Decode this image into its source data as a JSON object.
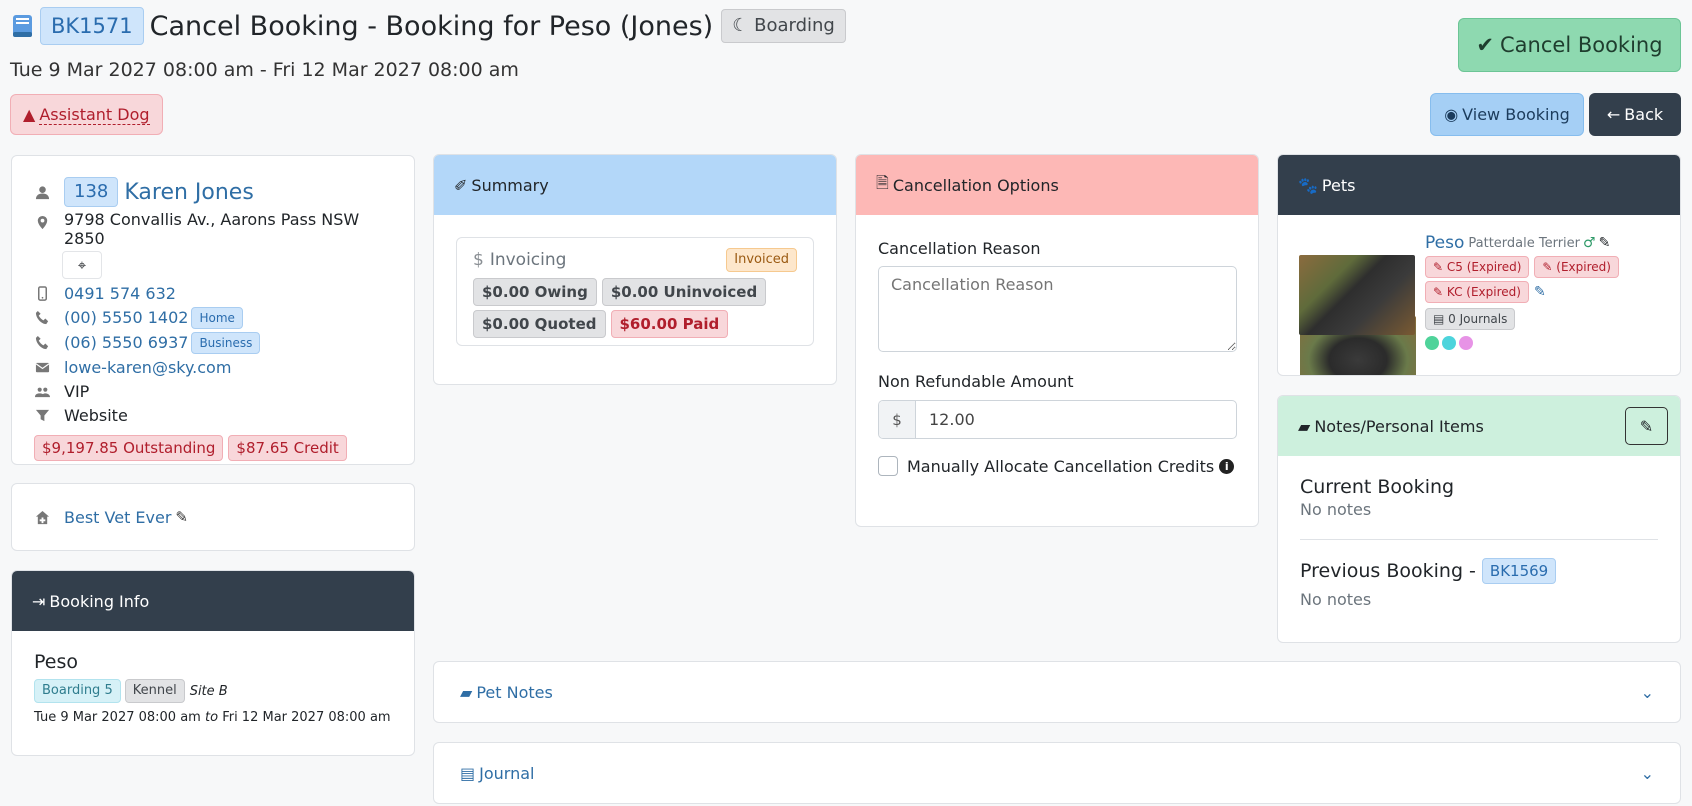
{
  "header": {
    "booking_id": "BK1571",
    "title": "Cancel Booking - Booking for Peso (Jones)",
    "service_badge": "Boarding",
    "date_range": "Tue 9 Mar 2027 08:00 am - Fri 12 Mar 2027 08:00 am",
    "alert_label": "Assistant Dog",
    "cancel_button": "Cancel Booking",
    "view_booking_button": "View Booking",
    "back_button": "Back"
  },
  "customer": {
    "id": "138",
    "name": "Karen Jones",
    "address": "9798 Convallis Av., Aarons Pass NSW 2850",
    "mobile": "0491 574 632",
    "phone_home": "(00) 5550 1402",
    "phone_home_label": "Home",
    "phone_business": "(06) 5550 6937",
    "phone_business_label": "Business",
    "email": "lowe-karen@sky.com",
    "group": "VIP",
    "source": "Website",
    "outstanding": "$9,197.85 Outstanding",
    "credit": "$87.65 Credit"
  },
  "vet": {
    "name": "Best Vet Ever"
  },
  "booking_info": {
    "title": "Booking Info",
    "pet_name": "Peso",
    "room": "Boarding 5",
    "room_type": "Kennel",
    "site": "Site B",
    "start": "Tue 9 Mar 2027 08:00 am",
    "to": "to",
    "end": "Fri 12 Mar 2027 08:00 am"
  },
  "summary": {
    "title": "Summary",
    "invoicing_label": "Invoicing",
    "status": "Invoiced",
    "owing": "$0.00 Owing",
    "uninvoiced": "$0.00 Uninvoiced",
    "quoted": "$0.00 Quoted",
    "paid": "$60.00 Paid"
  },
  "cancellation": {
    "title": "Cancellation Options",
    "reason_label": "Cancellation Reason",
    "reason_placeholder": "Cancellation Reason",
    "non_refundable_label": "Non Refundable Amount",
    "currency": "$",
    "non_refundable_value": "12.00",
    "manual_allocate_label": "Manually Allocate Cancellation Credits"
  },
  "pets": {
    "title": "Pets",
    "name": "Peso",
    "breed": "Patterdale Terrier",
    "vacc1": "C5 (Expired)",
    "vacc2": "(Expired)",
    "vacc3": "KC (Expired)",
    "journals": "0 Journals",
    "dot_colors": [
      "#4fd39a",
      "#4dd4dc",
      "#e793e6"
    ]
  },
  "notes": {
    "title": "Notes/Personal Items",
    "current_heading": "Current Booking",
    "current_text": "No notes",
    "previous_heading": "Previous Booking -",
    "previous_id": "BK1569",
    "previous_text": "No notes"
  },
  "sections": {
    "pet_notes": "Pet Notes",
    "journal": "Journal"
  },
  "colors": {
    "summary_head": "#b3d7f9",
    "cancel_head": "#fdb8b6",
    "dark_head": "#333f4c",
    "notes_head": "#cdf0dd",
    "cancel_btn": "#8ed9b0",
    "view_btn": "#a5cff5"
  }
}
